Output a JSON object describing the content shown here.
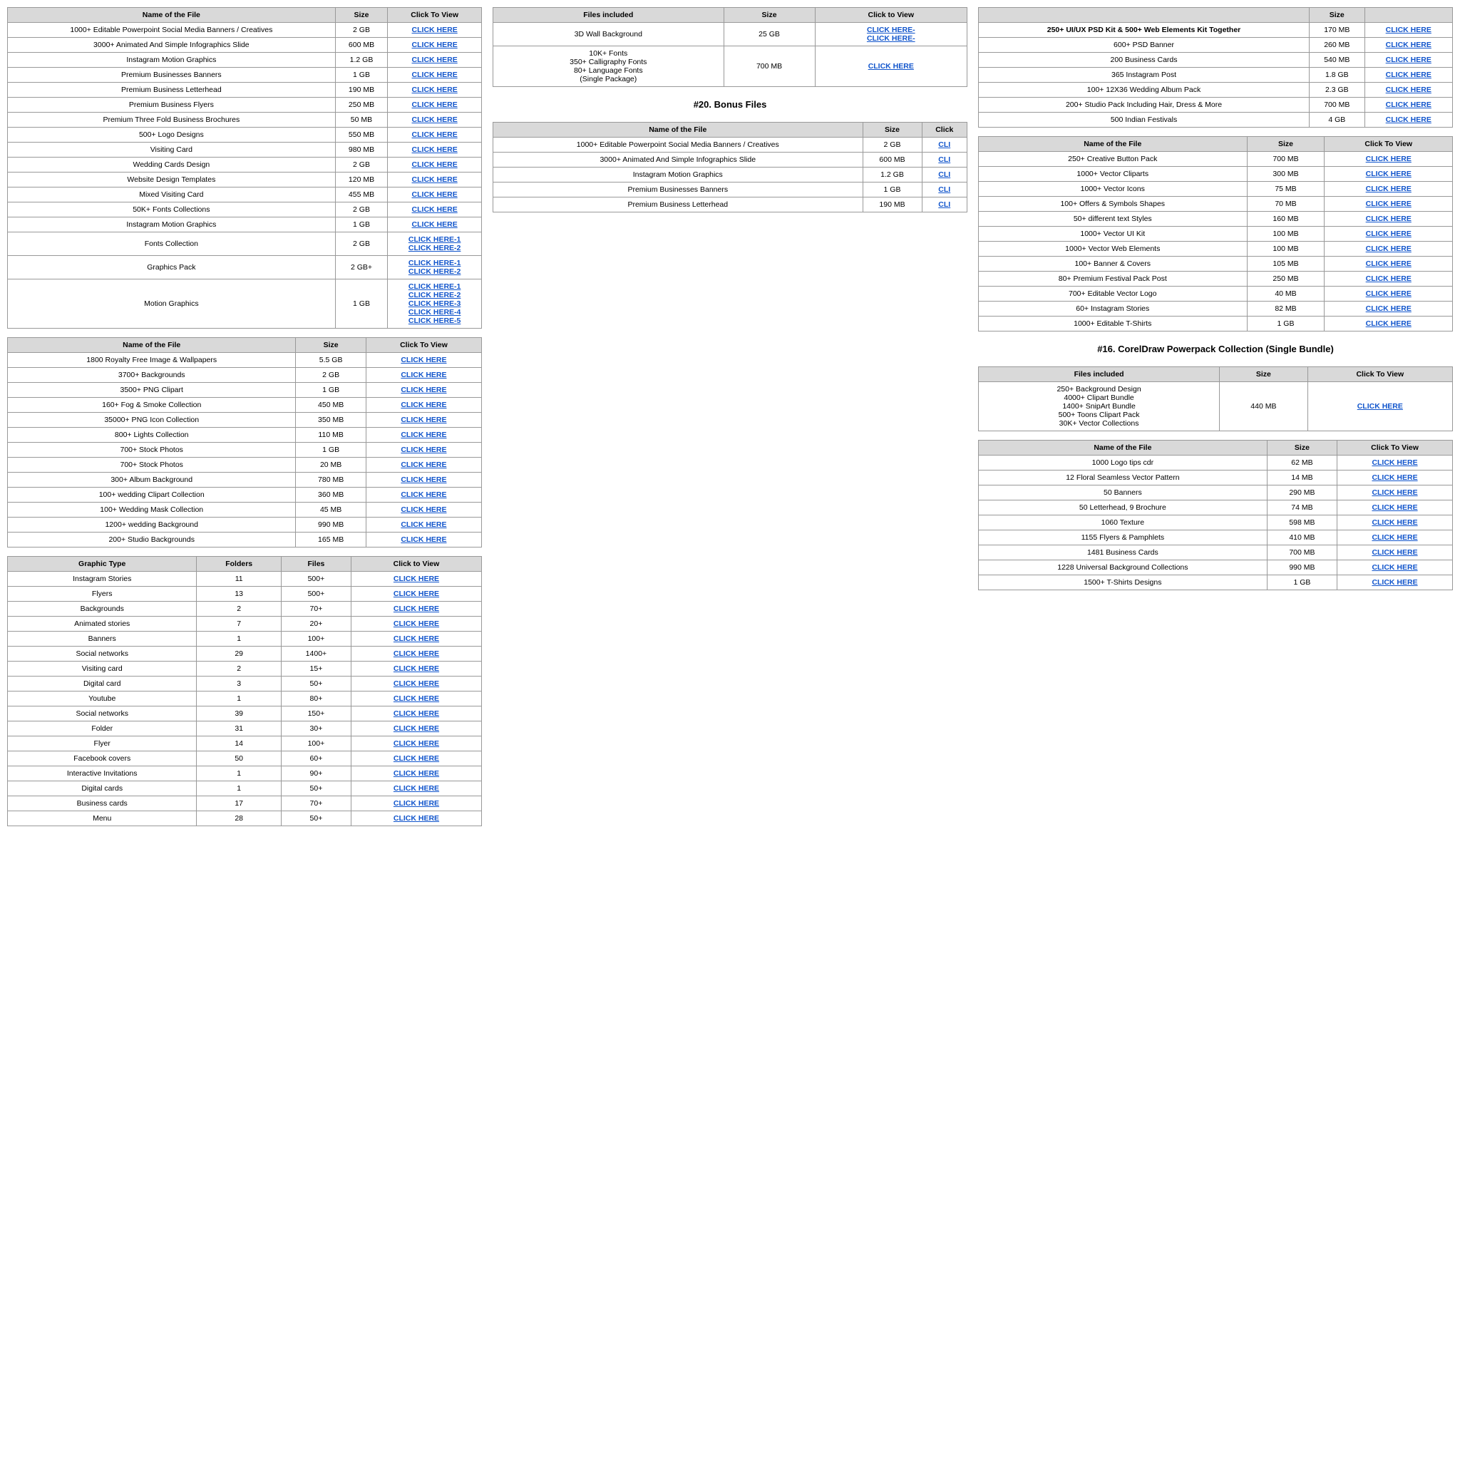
{
  "col1": {
    "table1": {
      "headers": [
        "Name of the File",
        "Size",
        "Click To View"
      ],
      "rows": [
        [
          "1000+ Editable Powerpoint Social Media Banners / Creatives",
          "2 GB",
          [
            "CLICK HERE"
          ]
        ],
        [
          "3000+ Animated And Simple Infographics Slide",
          "600 MB",
          [
            "CLICK HERE"
          ]
        ],
        [
          "Instagram Motion Graphics",
          "1.2 GB",
          [
            "CLICK HERE"
          ]
        ],
        [
          "Premium Businesses Banners",
          "1 GB",
          [
            "CLICK HERE"
          ]
        ],
        [
          "Premium Business Letterhead",
          "190 MB",
          [
            "CLICK HERE"
          ]
        ],
        [
          "Premium Business Flyers",
          "250 MB",
          [
            "CLICK HERE"
          ]
        ],
        [
          "Premium Three Fold Business Brochures",
          "50 MB",
          [
            "CLICK HERE"
          ]
        ],
        [
          "500+ Logo Designs",
          "550 MB",
          [
            "CLICK HERE"
          ]
        ],
        [
          "Visiting Card",
          "980 MB",
          [
            "CLICK HERE"
          ]
        ],
        [
          "Wedding Cards Design",
          "2 GB",
          [
            "CLICK HERE"
          ]
        ],
        [
          "Website Design Templates",
          "120 MB",
          [
            "CLICK HERE"
          ]
        ],
        [
          "Mixed Visiting Card",
          "455 MB",
          [
            "CLICK HERE"
          ]
        ],
        [
          "50K+ Fonts Collections",
          "2 GB",
          [
            "CLICK HERE"
          ]
        ],
        [
          "Instagram Motion Graphics",
          "1 GB",
          [
            "CLICK HERE"
          ]
        ],
        [
          "Fonts Collection",
          "2 GB",
          [
            "CLICK HERE-1",
            "CLICK HERE-2"
          ]
        ],
        [
          "Graphics Pack",
          "2 GB+",
          [
            "CLICK HERE-1",
            "CLICK HERE-2"
          ]
        ],
        [
          "Motion Graphics",
          "1 GB",
          [
            "CLICK HERE-1",
            "CLICK HERE-2",
            "CLICK HERE-3",
            "CLICK HERE-4",
            "CLICK HERE-5"
          ]
        ]
      ]
    },
    "table2": {
      "headers": [
        "Name of the File",
        "Size",
        "Click To View"
      ],
      "rows": [
        [
          "1800 Royalty Free Image & Wallpapers",
          "5.5 GB",
          [
            "CLICK HERE"
          ]
        ],
        [
          "3700+ Backgrounds",
          "2 GB",
          [
            "CLICK HERE"
          ]
        ],
        [
          "3500+ PNG Clipart",
          "1 GB",
          [
            "CLICK HERE"
          ]
        ],
        [
          "160+ Fog & Smoke Collection",
          "450 MB",
          [
            "CLICK HERE"
          ]
        ],
        [
          "35000+ PNG Icon Collection",
          "350 MB",
          [
            "CLICK HERE"
          ]
        ],
        [
          "800+ Lights Collection",
          "110 MB",
          [
            "CLICK HERE"
          ]
        ],
        [
          "700+ Stock Photos",
          "1 GB",
          [
            "CLICK HERE"
          ]
        ],
        [
          "700+ Stock Photos",
          "20 MB",
          [
            "CLICK HERE"
          ]
        ],
        [
          "300+ Album Background",
          "780 MB",
          [
            "CLICK HERE"
          ]
        ],
        [
          "100+ wedding Clipart Collection",
          "360 MB",
          [
            "CLICK HERE"
          ]
        ],
        [
          "100+ Wedding Mask Collection",
          "45 MB",
          [
            "CLICK HERE"
          ]
        ],
        [
          "1200+ wedding Background",
          "990 MB",
          [
            "CLICK HERE"
          ]
        ],
        [
          "200+ Studio Backgrounds",
          "165 MB",
          [
            "CLICK HERE"
          ]
        ]
      ]
    },
    "table3": {
      "headers": [
        "Graphic Type",
        "Folders",
        "Files",
        "Click to View"
      ],
      "rows": [
        [
          "Instagram Stories",
          "11",
          "500+",
          [
            "CLICK HERE"
          ]
        ],
        [
          "Flyers",
          "13",
          "500+",
          [
            "CLICK HERE"
          ]
        ],
        [
          "Backgrounds",
          "2",
          "70+",
          [
            "CLICK HERE"
          ]
        ],
        [
          "Animated stories",
          "7",
          "20+",
          [
            "CLICK HERE"
          ]
        ],
        [
          "Banners",
          "1",
          "100+",
          [
            "CLICK HERE"
          ]
        ],
        [
          "Social networks",
          "29",
          "1400+",
          [
            "CLICK HERE"
          ]
        ],
        [
          "Visiting card",
          "2",
          "15+",
          [
            "CLICK HERE"
          ]
        ],
        [
          "Digital card",
          "3",
          "50+",
          [
            "CLICK HERE"
          ]
        ],
        [
          "Youtube",
          "1",
          "80+",
          [
            "CLICK HERE"
          ]
        ],
        [
          "Social networks",
          "39",
          "150+",
          [
            "CLICK HERE"
          ]
        ],
        [
          "Folder",
          "31",
          "30+",
          [
            "CLICK HERE"
          ]
        ],
        [
          "Flyer",
          "14",
          "100+",
          [
            "CLICK HERE"
          ]
        ],
        [
          "Facebook covers",
          "50",
          "60+",
          [
            "CLICK HERE"
          ]
        ],
        [
          "Interactive Invitations",
          "1",
          "90+",
          [
            "CLICK HERE"
          ]
        ],
        [
          "Digital cards",
          "1",
          "50+",
          [
            "CLICK HERE"
          ]
        ],
        [
          "Business cards",
          "17",
          "70+",
          [
            "CLICK HERE"
          ]
        ],
        [
          "Menu",
          "28",
          "50+",
          [
            "CLICK HERE"
          ]
        ]
      ]
    }
  },
  "col2": {
    "table1": {
      "headers": [
        "Files included",
        "Size",
        "Click to View"
      ],
      "rows": [
        [
          "3D Wall Background",
          "25 GB",
          [
            "CLICK HERE-",
            "CLICK HERE-"
          ]
        ],
        [
          "10K+ Fonts\n350+ Calligraphy Fonts\n80+ Language Fonts\n(Single Package)",
          "700 MB",
          [
            "CLICK HERE"
          ]
        ]
      ]
    },
    "bonus_title": "#20. Bonus Files",
    "table2": {
      "headers": [
        "Name of the File",
        "Size",
        "Click"
      ],
      "rows": [
        [
          "1000+ Editable Powerpoint Social Media Banners / Creatives",
          "2 GB",
          [
            "CLI"
          ]
        ],
        [
          "3000+ Animated And Simple Infographics Slide",
          "600 MB",
          [
            "CLI"
          ]
        ],
        [
          "Instagram Motion Graphics",
          "1.2 GB",
          [
            "CLI"
          ]
        ],
        [
          "Premium Businesses Banners",
          "1 GB",
          [
            "CLI"
          ]
        ],
        [
          "Premium Business Letterhead",
          "190 MB",
          [
            "CLI"
          ]
        ]
      ]
    }
  },
  "col3": {
    "table1": {
      "headers": [
        "",
        "Size",
        ""
      ],
      "title_text": "250+ UI/UX PSD Kit & 500+ Web Elements Kit Together",
      "title_size": "170 MB",
      "title_link": "CLICK HERE",
      "rows": [
        [
          "600+ PSD Banner",
          "260 MB",
          [
            "CLICK HERE"
          ]
        ],
        [
          "200 Business Cards",
          "540 MB",
          [
            "CLICK HERE"
          ]
        ],
        [
          "365 Instagram Post",
          "1.8 GB",
          [
            "CLICK HERE"
          ]
        ],
        [
          "100+ 12X36 Wedding Album Pack",
          "2.3 GB",
          [
            "CLICK HERE"
          ]
        ],
        [
          "200+ Studio Pack Including Hair, Dress & More",
          "700 MB",
          [
            "CLICK HERE"
          ]
        ],
        [
          "500 Indian Festivals",
          "4 GB",
          [
            "CLICK HERE"
          ]
        ]
      ]
    },
    "table2": {
      "headers": [
        "Name of the File",
        "Size",
        "Click To View"
      ],
      "rows": [
        [
          "250+ Creative Button Pack",
          "700 MB",
          [
            "CLICK HERE"
          ]
        ],
        [
          "1000+ Vector Cliparts",
          "300 MB",
          [
            "CLICK HERE"
          ]
        ],
        [
          "1000+ Vector Icons",
          "75 MB",
          [
            "CLICK HERE"
          ]
        ],
        [
          "100+ Offers & Symbols Shapes",
          "70 MB",
          [
            "CLICK HERE"
          ]
        ],
        [
          "50+ different text Styles",
          "160 MB",
          [
            "CLICK HERE"
          ]
        ],
        [
          "1000+ Vector UI Kit",
          "100 MB",
          [
            "CLICK HERE"
          ]
        ],
        [
          "1000+ Vector Web Elements",
          "100 MB",
          [
            "CLICK HERE"
          ]
        ],
        [
          "100+ Banner & Covers",
          "105 MB",
          [
            "CLICK HERE"
          ]
        ],
        [
          "80+ Premium Festival Pack Post",
          "250 MB",
          [
            "CLICK HERE"
          ]
        ],
        [
          "700+ Editable Vector Logo",
          "40 MB",
          [
            "CLICK HERE"
          ]
        ],
        [
          "60+ Instagram Stories",
          "82 MB",
          [
            "CLICK HERE"
          ]
        ],
        [
          "1000+ Editable T-Shirts",
          "1 GB",
          [
            "CLICK HERE"
          ]
        ]
      ]
    },
    "coreldraw_title": "#16. CorelDraw Powerpack Collection (Single Bundle)",
    "table3": {
      "headers": [
        "Files included",
        "Size",
        "Click To View"
      ],
      "rows": [
        [
          "250+ Background Design\n4000+ Clipart Bundle\n1400+ SnipArt Bundle\n500+ Toons Clipart Pack\n30K+ Vector Collections",
          "440 MB",
          [
            "CLICK HERE"
          ]
        ]
      ]
    },
    "table4": {
      "headers": [
        "Name of the File",
        "Size",
        "Click To View"
      ],
      "rows": [
        [
          "1000 Logo tips cdr",
          "62 MB",
          [
            "CLICK HERE"
          ]
        ],
        [
          "12 Floral Seamless Vector Pattern",
          "14 MB",
          [
            "CLICK HERE"
          ]
        ],
        [
          "50 Banners",
          "290 MB",
          [
            "CLICK HERE"
          ]
        ],
        [
          "50 Letterhead, 9 Brochure",
          "74 MB",
          [
            "CLICK HERE"
          ]
        ],
        [
          "1060 Texture",
          "598 MB",
          [
            "CLICK HERE"
          ]
        ],
        [
          "1155 Flyers & Pamphlets",
          "410 MB",
          [
            "CLICK HERE"
          ]
        ],
        [
          "1481 Business Cards",
          "700 MB",
          [
            "CLICK HERE"
          ]
        ],
        [
          "1228 Universal Background Collections",
          "990 MB",
          [
            "CLICK HERE"
          ]
        ],
        [
          "1500+ T-Shirts Designs",
          "1 GB",
          [
            "CLICK HERE"
          ]
        ]
      ]
    }
  }
}
